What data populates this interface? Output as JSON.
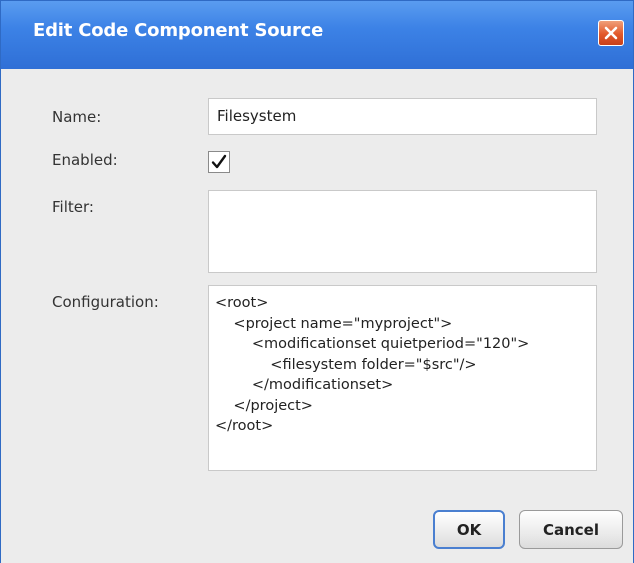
{
  "dialog": {
    "title": "Edit Code Component Source",
    "close_icon": "close-icon"
  },
  "form": {
    "name_label": "Name:",
    "name_value": "Filesystem",
    "enabled_label": "Enabled:",
    "enabled_checked": true,
    "filter_label": "Filter:",
    "filter_value": "",
    "configuration_label": "Configuration:",
    "configuration_lines": [
      "<root>",
      "    <project name=\"myproject\">",
      "        <modificationset quietperiod=\"120\">",
      "            <filesystem folder=\"$src\"/>",
      "        </modificationset>",
      "    </project>",
      "</root>"
    ]
  },
  "buttons": {
    "ok_label": "OK",
    "cancel_label": "Cancel"
  },
  "colors": {
    "titlebar": "#3c82e6",
    "close_button": "#e2592b",
    "body_background": "#ececec"
  }
}
